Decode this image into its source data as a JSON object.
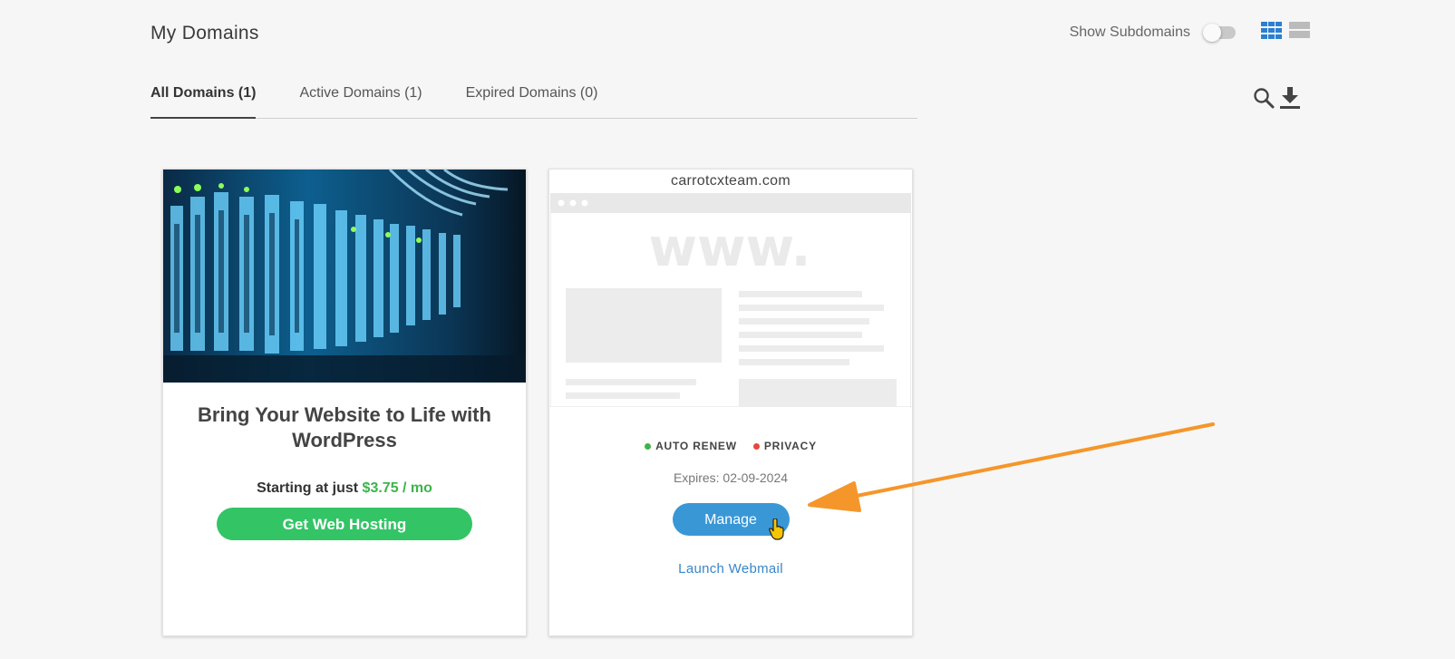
{
  "header": {
    "title": "My Domains",
    "show_subdomains_label": "Show Subdomains",
    "show_subdomains_on": false,
    "grid_view_icon": "grid-view-icon",
    "list_view_icon": "list-view-icon"
  },
  "tabs": [
    {
      "label": "All Domains (1)",
      "active": true
    },
    {
      "label": "Active Domains (1)",
      "active": false
    },
    {
      "label": "Expired Domains (0)",
      "active": false
    }
  ],
  "tools": {
    "search_icon": "search-icon",
    "download_icon": "download-icon"
  },
  "promo": {
    "title": "Bring Your Website to Life with WordPress",
    "price_prefix": "Starting at just",
    "price": "$3.75 / mo",
    "button_label": "Get Web Hosting"
  },
  "domain": {
    "name": "carrotcxteam.com",
    "placeholder_text": "www.",
    "auto_renew_label": "AUTO RENEW",
    "privacy_label": "PRIVACY",
    "expires": "Expires: 02-09-2024",
    "manage_label": "Manage",
    "webmail_label": "Launch Webmail"
  },
  "colors": {
    "accent_blue": "#3a97d6",
    "hosting_green": "#33c466",
    "auto_renew_dot": "#3cb44b",
    "privacy_dot": "#e5483d",
    "annotation_arrow": "#f5962a"
  }
}
